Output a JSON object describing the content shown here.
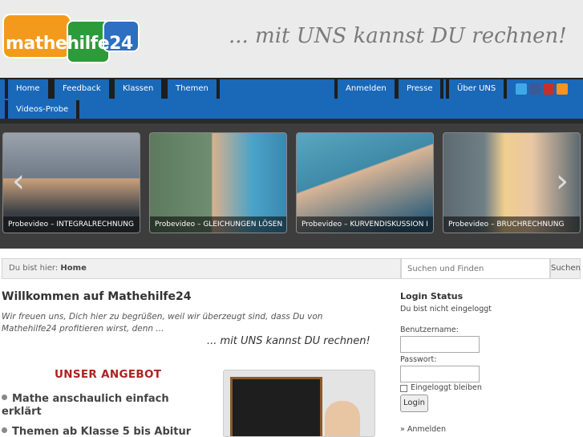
{
  "header": {
    "logo_text_left": "mathe",
    "logo_text_middle": "hilfe",
    "logo_text_right": "24",
    "slogan": "... mit UNS kannst DU rechnen!"
  },
  "nav": {
    "items": [
      "Home",
      "Feedback",
      "Klassen",
      "Themen",
      "Anmelden",
      "Presse",
      "Über UNS",
      "Videos-Probe"
    ],
    "social": [
      "twitter-icon",
      "facebook-icon",
      "youtube-icon",
      "rss-icon"
    ]
  },
  "slider": {
    "captions": [
      "Probevideo – INTEGRALRECHNUNG",
      "Probevideo – GLEICHUNGEN LÖSEN",
      "Probevideo – KURVENDISKUSSION I",
      "Probevideo – BRUCHRECHNUNG"
    ],
    "prev": "‹",
    "next": "›"
  },
  "breadcrumb": {
    "prefix": "Du bist hier:",
    "current": "Home"
  },
  "search": {
    "placeholder": "Suchen und Finden",
    "button": "Suchen"
  },
  "main": {
    "title": "Willkommen auf Mathehilfe24",
    "intro": "Wir freuen uns, Dich hier zu begrüßen, weil wir überzeugt sind, dass Du von Mathehilfe24 profitieren wirst, denn ...",
    "motto": "... mit UNS kannst DU rechnen!",
    "offer_heading": "UNSER ANGEBOT",
    "features": [
      "Mathe anschaulich einfach erklärt",
      "Themen ab Klasse 5 bis Abitur"
    ]
  },
  "sidebar": {
    "title": "Login Status",
    "status": "Du bist nicht eingeloggt",
    "username_label": "Benutzername:",
    "password_label": "Passwort:",
    "remember_label": "Eingeloggt bleiben",
    "login_button": "Login",
    "register_link": "» Anmelden"
  },
  "colors": {
    "nav_blue": "#1a68b8",
    "logo_orange": "#f39a1c",
    "logo_green": "#2e9b3a",
    "logo_blue": "#2d6fc0",
    "offer_red": "#b02020"
  }
}
